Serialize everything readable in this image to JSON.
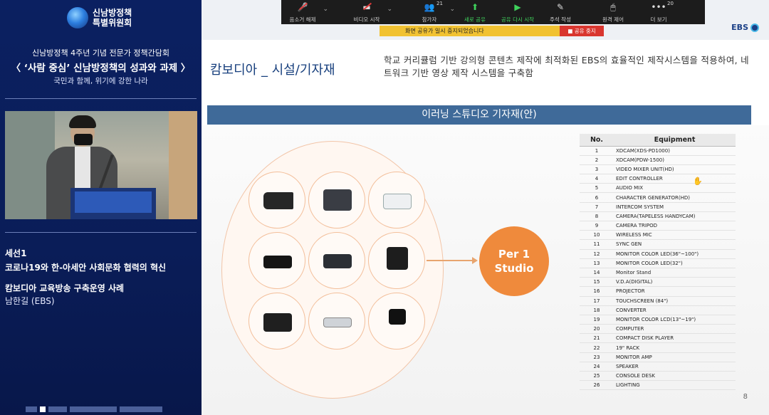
{
  "event": {
    "logo_text": "신남방정책\n특별위원회",
    "subtitle": "신남방정책 4주년 기념 전문가 정책간담회",
    "title": "〈 ‘사람 중심’ 신남방정책의 성과와 과제 〉",
    "tagline": "국민과 함께, 위기에 강한 나라"
  },
  "session": {
    "label": "세선1",
    "title": "코로나19와 한-아세안 사회문화 협력의 혁신",
    "talk": "캄보디아 교육방송 구축운영 사례",
    "speaker": "남한길 (EBS)"
  },
  "toolbar": {
    "items": [
      {
        "icon": "mic-muted-icon",
        "label": "음소거 해제"
      },
      {
        "icon": "video-muted-icon",
        "label": "비디오 시작"
      },
      {
        "icon": "participants-icon",
        "label": "참가자",
        "count": "21"
      },
      {
        "icon": "share-icon",
        "label": "새로 공유"
      },
      {
        "icon": "resume-share-icon",
        "label": "공유 다시 시작"
      },
      {
        "icon": "annotate-icon",
        "label": "주석 작성"
      },
      {
        "icon": "remote-control-icon",
        "label": "원격 제어"
      },
      {
        "icon": "more-icon",
        "label": "더 보기",
        "count": "20"
      }
    ],
    "share_paused": "화면 공유가 일시 중지되었습니다",
    "stop_share": "■ 공유 중지"
  },
  "slide": {
    "brand": "EBS",
    "heading": "캄보디아 _ 시설/기자재",
    "description": "학교 커리큘럼 기반 강의형 콘텐츠 제작에 최적화된 EBS의 효율적인 제작시스템을 적용하여, 네트워크 기반 영상 제작 시스템을 구축함",
    "section": "이러닝 스튜디오 기자재(안)",
    "studio_line1": "Per 1",
    "studio_line2": "Studio",
    "page": "8",
    "table": {
      "headers": [
        "No.",
        "Equipment"
      ],
      "rows": [
        [
          "1",
          "XDCAM(XDS-PD1000)"
        ],
        [
          "2",
          "XDCAM(PDW-1500)"
        ],
        [
          "3",
          "VIDEO MIXER UNIT(HD)"
        ],
        [
          "4",
          "EDIT CONTROLLER"
        ],
        [
          "5",
          "AUDIO MIX"
        ],
        [
          "6",
          "CHARACTER GENERATOR(HD)"
        ],
        [
          "7",
          "INTERCOM SYSTEM"
        ],
        [
          "8",
          "CAMERA(TAPELESS HANDYCAM)"
        ],
        [
          "9",
          "CAMERA TRIPOD"
        ],
        [
          "10",
          "WIRELESS MIC"
        ],
        [
          "11",
          "SYNC GEN"
        ],
        [
          "12",
          "MONITOR COLOR LED(36\"~100\")"
        ],
        [
          "13",
          "MONITOR COLOR LED(32\")"
        ],
        [
          "14",
          "Monitor Stand"
        ],
        [
          "15",
          "V.D.A(DIGITAL)"
        ],
        [
          "16",
          "PROJECTOR"
        ],
        [
          "17",
          "TOUCHSCREEN (84\")"
        ],
        [
          "18",
          "CONVERTER"
        ],
        [
          "19",
          "MONITOR COLOR LCD(13\"~19\")"
        ],
        [
          "20",
          "COMPUTER"
        ],
        [
          "21",
          "COMPACT DISK PLAYER"
        ],
        [
          "22",
          "19\" RACK"
        ],
        [
          "23",
          "MONITOR AMP"
        ],
        [
          "24",
          "SPEAKER"
        ],
        [
          "25",
          "CONSOLE DESK"
        ],
        [
          "26",
          "LIGHTING"
        ]
      ]
    }
  }
}
